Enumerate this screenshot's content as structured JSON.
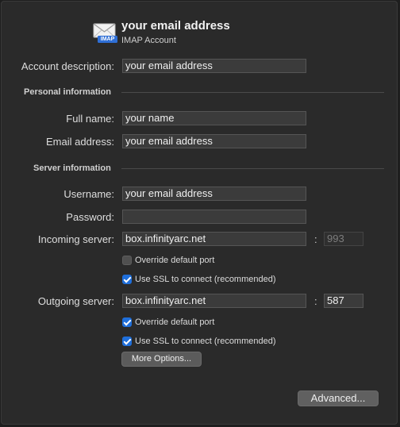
{
  "header": {
    "title": "your email address",
    "subtitle": "IMAP Account",
    "icon_badge": "IMAP",
    "icon": "mail-envelope-icon"
  },
  "account_description": {
    "label": "Account description:",
    "value": "your email address"
  },
  "personal": {
    "heading": "Personal information",
    "full_name": {
      "label": "Full name:",
      "value": "your name"
    },
    "email": {
      "label": "Email address:",
      "value": "your email address"
    }
  },
  "server": {
    "heading": "Server information",
    "username": {
      "label": "Username:",
      "value": "your email address"
    },
    "password": {
      "label": "Password:",
      "value": ""
    },
    "incoming": {
      "label": "Incoming server:",
      "host": "box.infinityarc.net",
      "port": "993",
      "override_label": "Override default port",
      "override_checked": false,
      "ssl_label": "Use SSL to connect (recommended)",
      "ssl_checked": true
    },
    "outgoing": {
      "label": "Outgoing server:",
      "host": "box.infinityarc.net",
      "port": "587",
      "override_label": "Override default port",
      "override_checked": true,
      "ssl_label": "Use SSL to connect (recommended)",
      "ssl_checked": true
    },
    "colon": ":"
  },
  "buttons": {
    "more_options": "More Options...",
    "advanced": "Advanced..."
  },
  "colors": {
    "accent": "#1f6fdb",
    "background": "#2a2a2a"
  }
}
